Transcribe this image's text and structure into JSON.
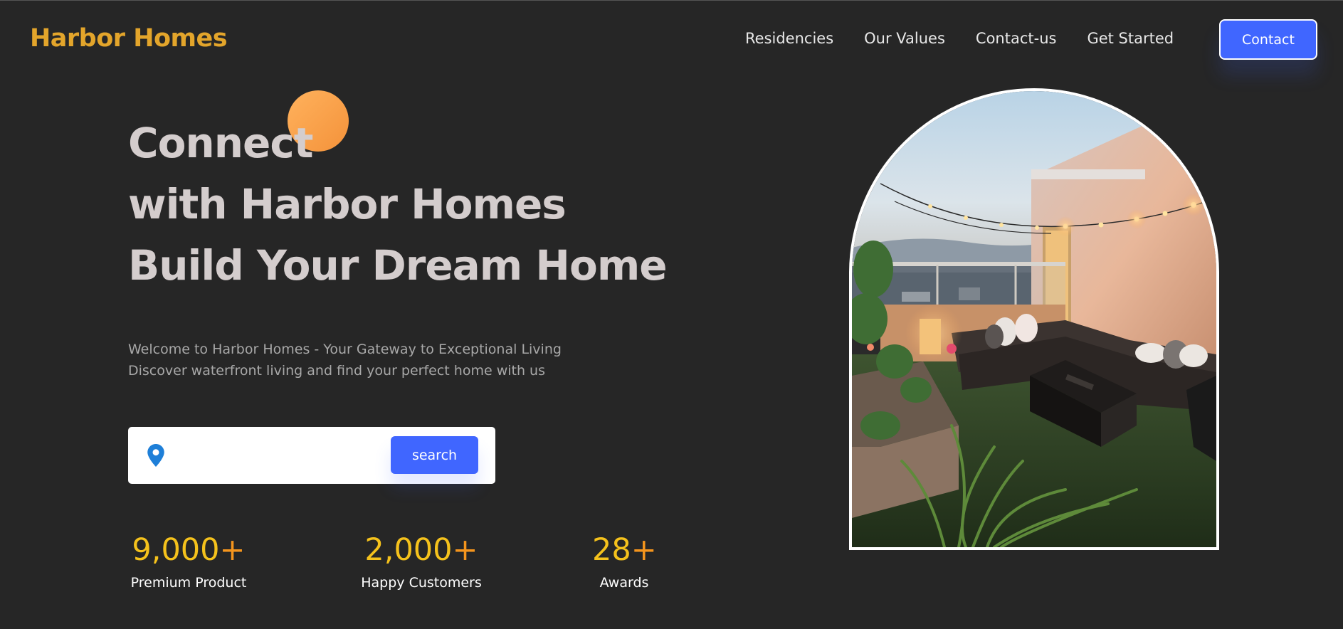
{
  "header": {
    "logo": "Harbor Homes",
    "nav": [
      "Residencies",
      "Our Values",
      "Contact-us",
      "Get Started"
    ],
    "contact_button": "Contact"
  },
  "hero": {
    "title_lines": [
      "Connect",
      "with Harbor Homes",
      "Build Your Dream Home"
    ],
    "subtitle_lines": [
      "Welcome to Harbor Homes - Your Gateway to Exceptional Living",
      "Discover waterfront living and find your perfect home with us"
    ]
  },
  "search": {
    "value": "",
    "placeholder": "",
    "button_label": "search",
    "icon": "location-pin-icon"
  },
  "stats": [
    {
      "number": "9,000",
      "plus": "+",
      "label": "Premium Product"
    },
    {
      "number": "2,000",
      "plus": "+",
      "label": "Happy Customers"
    },
    {
      "number": "28",
      "plus": "+",
      "label": "Awards"
    }
  ],
  "colors": {
    "background": "#262626",
    "accent_blue": "#4066ff",
    "logo_gold": "#e3a52b",
    "stat_yellow": "#f5c21c",
    "stat_orange": "#f5951d",
    "circle_orange": "#f4923a"
  }
}
